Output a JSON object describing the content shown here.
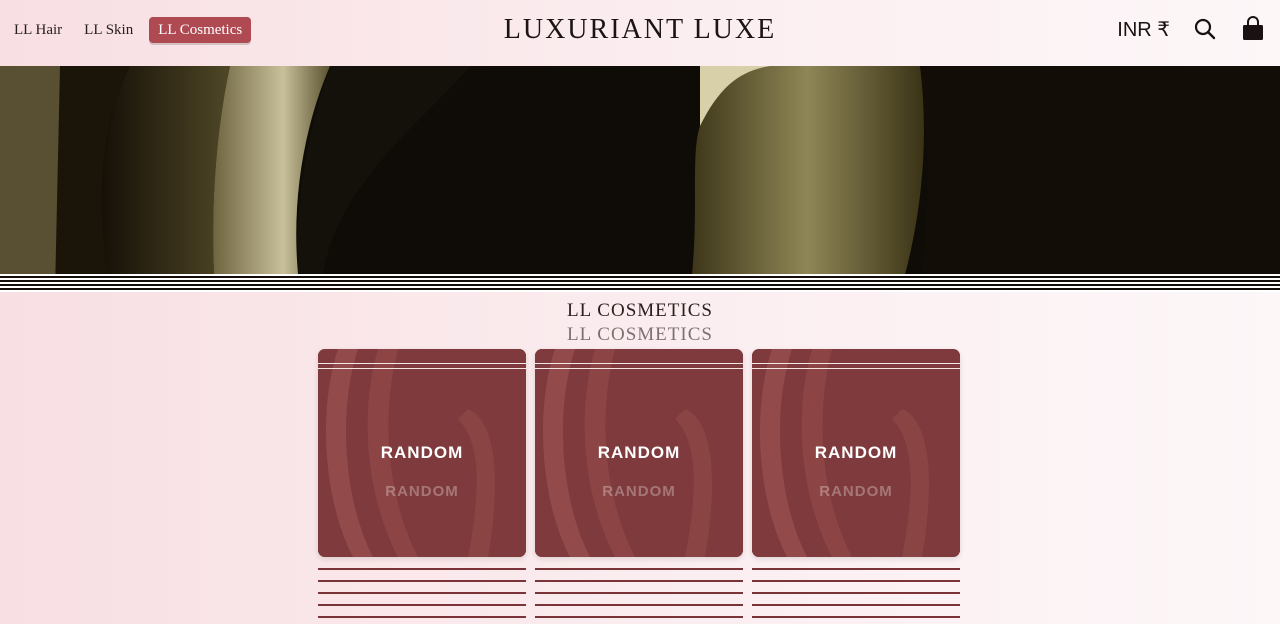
{
  "header": {
    "brand_tabs": [
      {
        "label": "LL Hair",
        "active": false
      },
      {
        "label": "LL Skin",
        "active": false
      },
      {
        "label": "LL Cosmetics",
        "active": true
      }
    ],
    "logo": "LUXURIANT LUXE",
    "currency": "INR ₹",
    "icons": [
      "search-icon",
      "shopping-bag-icon"
    ]
  },
  "section": {
    "title": "LL COSMETICS"
  },
  "cards": [
    {
      "label": "RANDOM"
    },
    {
      "label": "RANDOM"
    },
    {
      "label": "RANDOM"
    }
  ],
  "colors": {
    "accent": "#b04a52",
    "card_bg": "#7e3a3c",
    "hero_bg": "#0f0b06"
  }
}
